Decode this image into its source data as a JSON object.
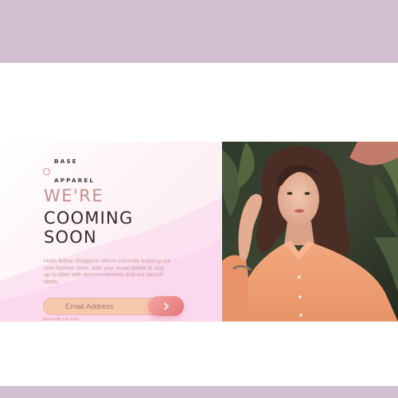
{
  "brand": {
    "line1": "BASE",
    "line2": "APPAREL"
  },
  "hero": {
    "title_light": "WE'RE",
    "title_line2": "COOMING",
    "title_line3": "SOON",
    "description": "Hello fellow shoppers! We're currently building our new fashion store. Add your email below to stay up-to-date with announcements and our launch deals."
  },
  "form": {
    "email_placeholder": "Email Address",
    "email_value": "",
    "submit_icon": "arrow-right-icon",
    "hint": "Plese enter your email"
  },
  "colors": {
    "frame_band": "#d2bfd1",
    "accent": "#e27575",
    "heading_light": "#c58e8e",
    "heading_dark": "#3b2a2d"
  }
}
